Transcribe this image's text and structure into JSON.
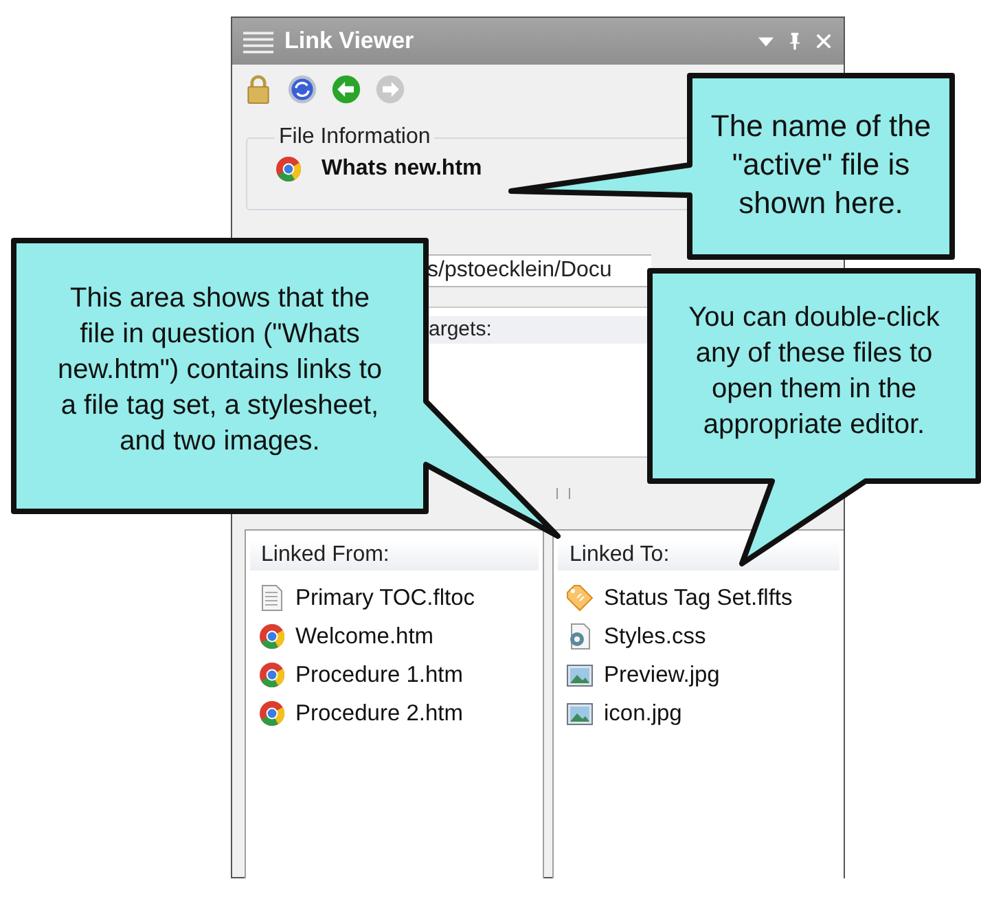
{
  "window": {
    "title": "Link Viewer"
  },
  "toolbar": [
    {
      "kind": "lock",
      "disabled": false
    },
    {
      "kind": "refresh",
      "disabled": false
    },
    {
      "kind": "back",
      "disabled": false
    },
    {
      "kind": "forward",
      "disabled": true
    }
  ],
  "file_information": {
    "label": "File Information",
    "file_name": "Whats new.htm"
  },
  "file_path": {
    "value": "s/pstoecklein/Docu"
  },
  "targets": {
    "header": "argets:"
  },
  "linked_from": {
    "header": "Linked From:",
    "items": [
      {
        "kind": "toc",
        "name": "Primary TOC.fltoc"
      },
      {
        "kind": "htm",
        "name": "Welcome.htm"
      },
      {
        "kind": "htm",
        "name": "Procedure 1.htm"
      },
      {
        "kind": "htm",
        "name": "Procedure 2.htm"
      }
    ]
  },
  "linked_to": {
    "header": "Linked To:",
    "items": [
      {
        "kind": "tag_set",
        "name": "Status Tag Set.flfts"
      },
      {
        "kind": "css",
        "name": "Styles.css"
      },
      {
        "kind": "image",
        "name": "Preview.jpg"
      },
      {
        "kind": "image",
        "name": "icon.jpg"
      }
    ]
  },
  "callouts": [
    {
      "text": "The name of the\n\"active\" file is\nshown here."
    },
    {
      "text": "This area shows that the\nfile in question (\"Whats\nnew.htm\") contains links to\na file tag set, a stylesheet,\nand two images."
    },
    {
      "text": "You can double-click\nany of these files to\nopen them in the\nappropriate editor."
    }
  ]
}
